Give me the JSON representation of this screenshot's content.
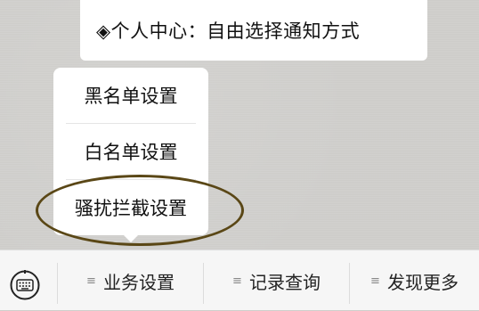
{
  "notice": {
    "text": "◈个人中心：自由选择通知方式"
  },
  "popup_menu": {
    "items": [
      {
        "label": "黑名单设置"
      },
      {
        "label": "白名单设置"
      },
      {
        "label": "骚扰拦截设置"
      }
    ],
    "highlighted_item": "骚扰拦截设置"
  },
  "bottom_bar": {
    "keyboard_icon": "keyboard-icon",
    "tabs": [
      {
        "label": "业务设置",
        "icon": "menu-lines-icon"
      },
      {
        "label": "记录查询",
        "icon": "menu-lines-icon"
      },
      {
        "label": "发现更多",
        "icon": "menu-lines-icon"
      }
    ]
  },
  "colors": {
    "background": "#d1d0cd",
    "highlight_ellipse": "#5a4716",
    "bar_background": "#f6f6f6"
  }
}
